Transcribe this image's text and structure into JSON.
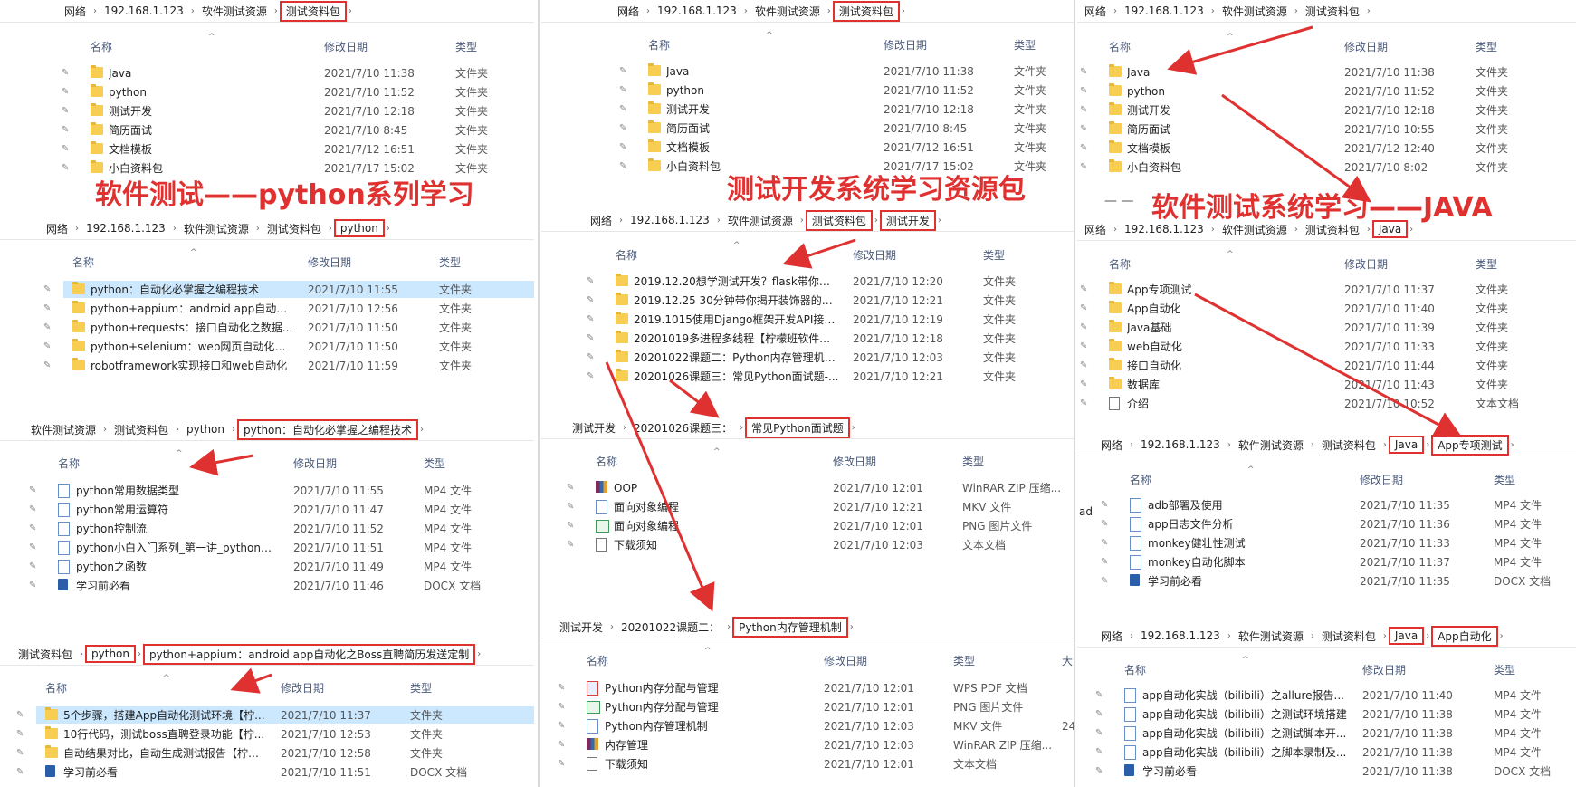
{
  "headers": {
    "name": "名称",
    "date": "修改日期",
    "type": "类型",
    "size": "大"
  },
  "col1": {
    "bc1": [
      "网络",
      "192.168.1.123",
      "软件测试资源",
      "测试资料包"
    ],
    "rows1": [
      {
        "name": "Java",
        "date": "2021/7/10 11:38",
        "type": "文件夹"
      },
      {
        "name": "python",
        "date": "2021/7/10 11:52",
        "type": "文件夹"
      },
      {
        "name": "测试开发",
        "date": "2021/7/10 12:18",
        "type": "文件夹"
      },
      {
        "name": "简历面试",
        "date": "2021/7/10 8:45",
        "type": "文件夹"
      },
      {
        "name": "文档模板",
        "date": "2021/7/12 16:51",
        "type": "文件夹"
      },
      {
        "name": "小白资料包",
        "date": "2021/7/17 15:02",
        "type": "文件夹"
      }
    ],
    "anno": "软件测试——python系列学习",
    "bc2": [
      "网络",
      "192.168.1.123",
      "软件测试资源",
      "测试资料包",
      "python"
    ],
    "rows2": [
      {
        "name": "python：自动化必掌握之编程技术",
        "date": "2021/7/10 11:55",
        "type": "文件夹"
      },
      {
        "name": "python+appium：android app自动化...",
        "date": "2021/7/10 12:56",
        "type": "文件夹"
      },
      {
        "name": "python+requests：接口自动化之数据...",
        "date": "2021/7/10 11:50",
        "type": "文件夹"
      },
      {
        "name": "python+selenium：web网页自动化之...",
        "date": "2021/7/10 11:50",
        "type": "文件夹"
      },
      {
        "name": "robotframework实现接口和web自动化",
        "date": "2021/7/10 11:59",
        "type": "文件夹"
      }
    ],
    "bc3": [
      "软件测试资源",
      "测试资料包",
      "python",
      "python：自动化必掌握之编程技术"
    ],
    "rows3": [
      {
        "name": "python常用数据类型",
        "date": "2021/7/10 11:55",
        "type": "MP4 文件"
      },
      {
        "name": "python常用运算符",
        "date": "2021/7/10 11:47",
        "type": "MP4 文件"
      },
      {
        "name": "python控制流",
        "date": "2021/7/10 11:52",
        "type": "MP4 文件"
      },
      {
        "name": "python小白入门系列_第一讲_python语...",
        "date": "2021/7/10 11:51",
        "type": "MP4 文件"
      },
      {
        "name": "python之函数",
        "date": "2021/7/10 11:49",
        "type": "MP4 文件"
      },
      {
        "name": "学习前必看",
        "date": "2021/7/10 11:46",
        "type": "DOCX 文档"
      }
    ],
    "bc4": [
      "测试资料包",
      "python",
      "python+appium：android app自动化之Boss直聘简历发送定制"
    ],
    "rows4": [
      {
        "name": "5个步骤，搭建App自动化测试环境【柠...",
        "date": "2021/7/10 11:37",
        "type": "文件夹"
      },
      {
        "name": "10行代码，测试boss直聘登录功能【柠...",
        "date": "2021/7/10 12:53",
        "type": "文件夹"
      },
      {
        "name": "自动结果对比，自动生成测试报告【柠檬...",
        "date": "2021/7/10 12:58",
        "type": "文件夹"
      },
      {
        "name": "学习前必看",
        "date": "2021/7/10 11:51",
        "type": "DOCX 文档"
      }
    ]
  },
  "col2": {
    "bc1": [
      "网络",
      "192.168.1.123",
      "软件测试资源",
      "测试资料包"
    ],
    "rows1": [
      {
        "name": "Java",
        "date": "2021/7/10 11:38",
        "type": "文件夹"
      },
      {
        "name": "python",
        "date": "2021/7/10 11:52",
        "type": "文件夹"
      },
      {
        "name": "测试开发",
        "date": "2021/7/10 12:18",
        "type": "文件夹"
      },
      {
        "name": "简历面试",
        "date": "2021/7/10 8:45",
        "type": "文件夹"
      },
      {
        "name": "文档模板",
        "date": "2021/7/12 16:51",
        "type": "文件夹"
      },
      {
        "name": "小白资料包",
        "date": "2021/7/17 15:02",
        "type": "文件夹"
      }
    ],
    "anno": "测试开发系统学习资源包",
    "bc2": [
      "网络",
      "192.168.1.123",
      "软件测试资源",
      "测试资料包",
      "测试开发"
    ],
    "rows2": [
      {
        "name": "2019.12.20想学测试开发？flask带你轻...",
        "date": "2021/7/10 12:20",
        "type": "文件夹"
      },
      {
        "name": "2019.12.25 30分钟带你揭开装饰器的真...",
        "date": "2021/7/10 12:21",
        "type": "文件夹"
      },
      {
        "name": "2019.1015使用Django框架开发API接口...",
        "date": "2021/7/10 12:19",
        "type": "文件夹"
      },
      {
        "name": "20201019多进程多线程【柠檬班软件测...",
        "date": "2021/7/10 12:18",
        "type": "文件夹"
      },
      {
        "name": "20201022课题二：Python内存管理机制...",
        "date": "2021/7/10 12:03",
        "type": "文件夹"
      },
      {
        "name": "20201026课题三：常见Python面试题-...",
        "date": "2021/7/10 12:21",
        "type": "文件夹"
      }
    ],
    "bc3": [
      "测试开发",
      "20201026课题三：",
      "常见Python面试题"
    ],
    "rows3": [
      {
        "name": "OOP",
        "date": "2021/7/10 12:01",
        "type": "WinRAR ZIP 压缩...",
        "icon": "zip"
      },
      {
        "name": "面向对象编程",
        "date": "2021/7/10 12:21",
        "type": "MKV 文件",
        "icon": "file"
      },
      {
        "name": "面向对象编程",
        "date": "2021/7/10 12:01",
        "type": "PNG 图片文件",
        "icon": "img"
      },
      {
        "name": "下载须知",
        "date": "2021/7/10 12:03",
        "type": "文本文档",
        "icon": "txt"
      }
    ],
    "bc4": [
      "测试开发",
      "20201022课题二：",
      "Python内存管理机制"
    ],
    "rows4": [
      {
        "name": "Python内存分配与管理",
        "date": "2021/7/10 12:01",
        "type": "WPS PDF 文档",
        "icon": "pdf"
      },
      {
        "name": "Python内存分配与管理",
        "date": "2021/7/10 12:01",
        "type": "PNG 图片文件",
        "icon": "img"
      },
      {
        "name": "Python内存管理机制",
        "date": "2021/7/10 12:03",
        "type": "MKV 文件",
        "icon": "file",
        "extra": "24"
      },
      {
        "name": "内存管理",
        "date": "2021/7/10 12:03",
        "type": "WinRAR ZIP 压缩...",
        "icon": "zip"
      },
      {
        "name": "下载须知",
        "date": "2021/7/10 12:01",
        "type": "文本文档",
        "icon": "txt"
      }
    ]
  },
  "col3": {
    "bc1": [
      "网络",
      "192.168.1.123",
      "软件测试资源",
      "测试资料包"
    ],
    "rows1": [
      {
        "name": "Java",
        "date": "2021/7/10 11:38",
        "type": "文件夹"
      },
      {
        "name": "python",
        "date": "2021/7/10 11:52",
        "type": "文件夹"
      },
      {
        "name": "测试开发",
        "date": "2021/7/10 12:18",
        "type": "文件夹"
      },
      {
        "name": "简历面试",
        "date": "2021/7/10 10:55",
        "type": "文件夹"
      },
      {
        "name": "文档模板",
        "date": "2021/7/12 12:40",
        "type": "文件夹"
      },
      {
        "name": "小白资料包",
        "date": "2021/7/10 8:02",
        "type": "文件夹"
      }
    ],
    "anno": "软件测试系统学习——JAVA",
    "bc2": [
      "网络",
      "192.168.1.123",
      "软件测试资源",
      "测试资料包",
      "Java"
    ],
    "rows2": [
      {
        "name": "App专项测试",
        "date": "2021/7/10 11:37",
        "type": "文件夹"
      },
      {
        "name": "App自动化",
        "date": "2021/7/10 11:40",
        "type": "文件夹"
      },
      {
        "name": "Java基础",
        "date": "2021/7/10 11:39",
        "type": "文件夹"
      },
      {
        "name": "web自动化",
        "date": "2021/7/10 11:33",
        "type": "文件夹"
      },
      {
        "name": "接口自动化",
        "date": "2021/7/10 11:44",
        "type": "文件夹"
      },
      {
        "name": "数据库",
        "date": "2021/7/10 11:43",
        "type": "文件夹"
      },
      {
        "name": "介绍",
        "date": "2021/7/10 10:52",
        "type": "文本文档",
        "icon": "txt"
      }
    ],
    "bc3": [
      "网络",
      "192.168.1.123",
      "软件测试资源",
      "测试资料包",
      "Java",
      "App专项测试"
    ],
    "rows3": [
      {
        "name": "adb部署及使用",
        "date": "2021/7/10 11:35",
        "type": "MP4 文件"
      },
      {
        "name": "app日志文件分析",
        "date": "2021/7/10 11:36",
        "type": "MP4 文件"
      },
      {
        "name": "monkey健壮性测试",
        "date": "2021/7/10 11:33",
        "type": "MP4 文件"
      },
      {
        "name": "monkey自动化脚本",
        "date": "2021/7/10 11:37",
        "type": "MP4 文件"
      },
      {
        "name": "学习前必看",
        "date": "2021/7/10 11:35",
        "type": "DOCX 文档"
      }
    ],
    "bc4": [
      "网络",
      "192.168.1.123",
      "软件测试资源",
      "测试资料包",
      "Java",
      "App自动化"
    ],
    "rows4": [
      {
        "name": "app自动化实战（bilibili）之allure报告...",
        "date": "2021/7/10 11:40",
        "type": "MP4 文件"
      },
      {
        "name": "app自动化实战（bilibili）之测试环境搭建",
        "date": "2021/7/10 11:38",
        "type": "MP4 文件"
      },
      {
        "name": "app自动化实战（bilibili）之测试脚本开...",
        "date": "2021/7/10 11:38",
        "type": "MP4 文件"
      },
      {
        "name": "app自动化实战（bilibili）之脚本录制及...",
        "date": "2021/7/10 11:38",
        "type": "MP4 文件"
      },
      {
        "name": "学习前必看",
        "date": "2021/7/10 11:38",
        "type": "DOCX 文档"
      }
    ],
    "side_label": "ad",
    "dash": "— —"
  },
  "colors": {
    "red": "#e03131",
    "selection": "#cce8ff",
    "folder": "#f7cd52"
  }
}
